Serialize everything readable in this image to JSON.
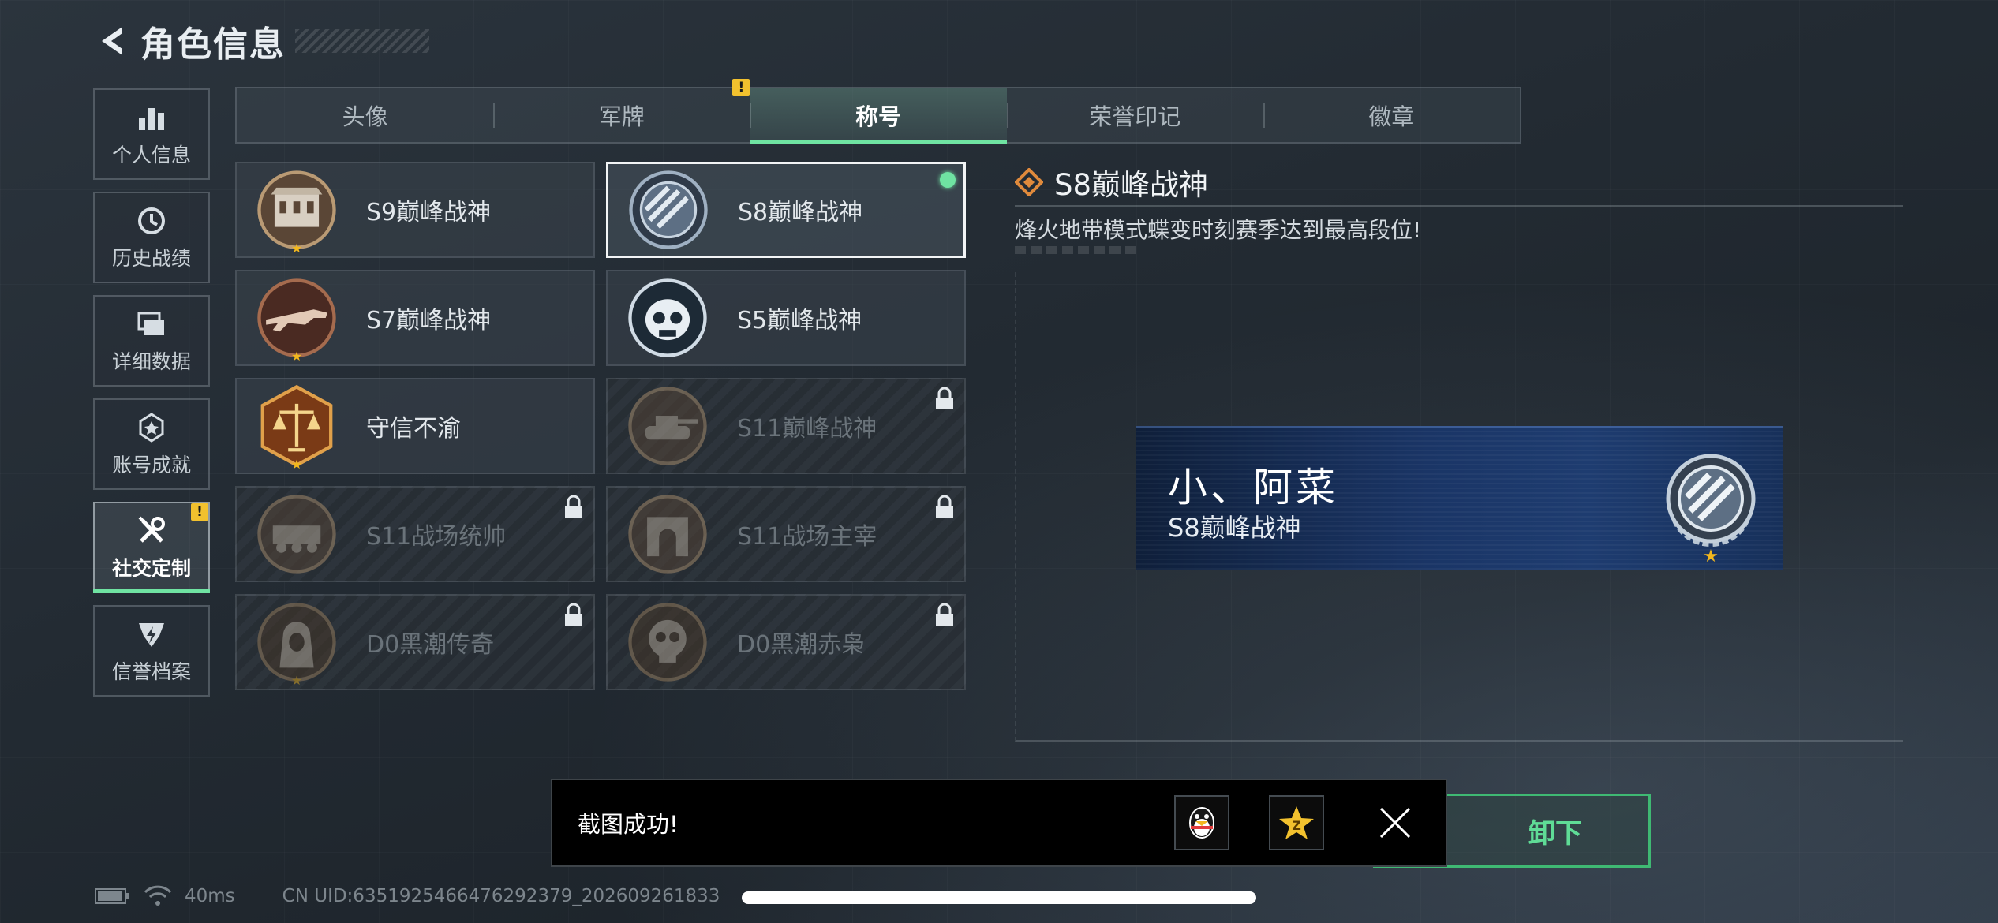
{
  "header": {
    "title": "角色信息"
  },
  "sidebar": {
    "items": [
      {
        "label": "个人信息"
      },
      {
        "label": "历史战绩"
      },
      {
        "label": "详细数据"
      },
      {
        "label": "账号成就"
      },
      {
        "label": "社交定制",
        "active": true,
        "badge": "!"
      },
      {
        "label": "信誉档案"
      }
    ]
  },
  "tabs": [
    {
      "label": "头像"
    },
    {
      "label": "军牌",
      "badge": "!"
    },
    {
      "label": "称号",
      "active": true
    },
    {
      "label": "荣誉印记"
    },
    {
      "label": "徽章"
    }
  ],
  "titles": [
    {
      "name": "S9巅峰战神",
      "locked": false,
      "icon": "fortress-emblem-icon"
    },
    {
      "name": "S8巅峰战神",
      "locked": false,
      "selected": true,
      "equipped": true,
      "icon": "striped-shield-emblem-icon"
    },
    {
      "name": "S7巅峰战神",
      "locked": false,
      "icon": "rifle-emblem-icon"
    },
    {
      "name": "S5巅峰战神",
      "locked": false,
      "icon": "skull-mask-emblem-icon"
    },
    {
      "name": "守信不渝",
      "locked": false,
      "icon": "scales-emblem-icon"
    },
    {
      "name": "S11巅峰战神",
      "locked": true,
      "icon": "tank-emblem-icon"
    },
    {
      "name": "S11战场统帅",
      "locked": true,
      "icon": "armored-vehicle-emblem-icon"
    },
    {
      "name": "S11战场主宰",
      "locked": true,
      "icon": "arch-emblem-icon"
    },
    {
      "name": "D0黑潮传奇",
      "locked": true,
      "icon": "hooded-figure-emblem-icon"
    },
    {
      "name": "D0黑潮赤枭",
      "locked": true,
      "icon": "skull-emblem-icon"
    }
  ],
  "detail": {
    "title": "S8巅峰战神",
    "description": "烽火地带模式蝶变时刻赛季达到最高段位!"
  },
  "nameplate": {
    "player_name": "小、阿菜",
    "title": "S8巅峰战神"
  },
  "action": {
    "label": "卸下"
  },
  "toast": {
    "message": "截图成功!"
  },
  "status": {
    "latency": "40ms",
    "uid": "CN UID:6351925466476292379_202609261833"
  },
  "colors": {
    "accent": "#6fe3a2",
    "warning": "#f2c12e",
    "star": "#f2b71e"
  }
}
